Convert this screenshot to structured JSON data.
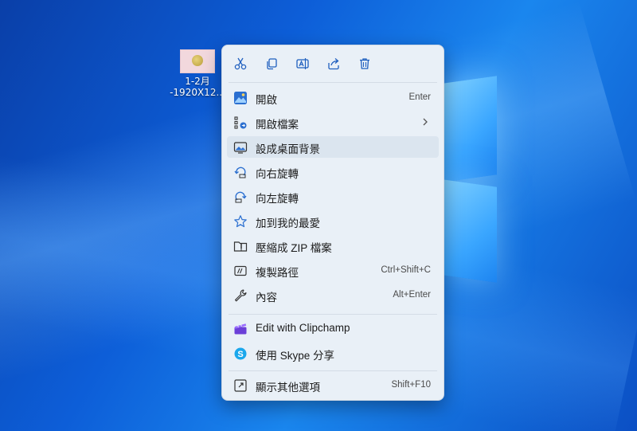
{
  "desktop": {
    "file": {
      "line1": "1-2月",
      "line2": "-1920X12..."
    }
  },
  "context_menu": {
    "toolbar": [
      {
        "icon": "scissors-icon",
        "name": "cut-button"
      },
      {
        "icon": "copy-icon",
        "name": "copy-button"
      },
      {
        "icon": "rename-icon",
        "name": "rename-button"
      },
      {
        "icon": "share-icon",
        "name": "share-button"
      },
      {
        "icon": "trash-icon",
        "name": "delete-button"
      }
    ],
    "items": [
      {
        "label": "開啟",
        "shortcut": "Enter",
        "icon": "photos-app-icon"
      },
      {
        "label": "開啟檔案",
        "shortcut": "",
        "icon": "open-with-icon",
        "submenu": true
      },
      {
        "label": "設成桌面背景",
        "shortcut": "",
        "icon": "wallpaper-icon",
        "highlighted": true
      },
      {
        "label": "向右旋轉",
        "shortcut": "",
        "icon": "rotate-right-icon"
      },
      {
        "label": "向左旋轉",
        "shortcut": "",
        "icon": "rotate-left-icon"
      },
      {
        "label": "加到我的最愛",
        "shortcut": "",
        "icon": "star-icon"
      },
      {
        "label": "壓縮成 ZIP 檔案",
        "shortcut": "",
        "icon": "zip-folder-icon"
      },
      {
        "label": "複製路徑",
        "shortcut": "Ctrl+Shift+C",
        "icon": "copy-path-icon"
      },
      {
        "label": "內容",
        "shortcut": "Alt+Enter",
        "icon": "wrench-icon"
      },
      {
        "label": "Edit with Clipchamp",
        "shortcut": "",
        "icon": "clipchamp-icon"
      },
      {
        "label": "使用 Skype 分享",
        "shortcut": "",
        "icon": "skype-icon"
      },
      {
        "label": "顯示其他選項",
        "shortcut": "Shift+F10",
        "icon": "more-options-icon"
      }
    ]
  },
  "colors": {
    "accent": "#0067c0",
    "menu_bg": "#e9f0f7",
    "hover": "#dbe5ef"
  }
}
